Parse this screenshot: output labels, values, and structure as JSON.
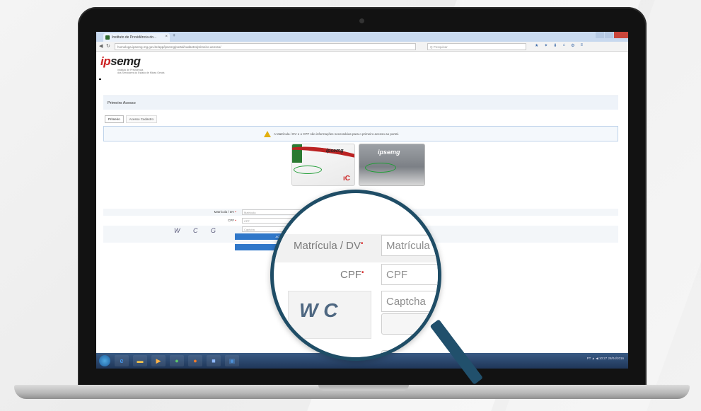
{
  "browser": {
    "tab_title": "Instituto de Previdência do...",
    "tab_close": "×",
    "new_tab": "+",
    "url": "homologa.ipsemg.mg.gov.br/app/ipsemg/portal/cadastro/primeiro-acesso/",
    "search_placeholder": "Q Pesquisar",
    "nav_back": "◀",
    "nav_refresh": "↻"
  },
  "site": {
    "logo_prefix": "ip",
    "logo_main": "semg",
    "logo_subtitle_1": "Instituto de Previdência",
    "logo_subtitle_2": "dos Servidores do Estado de Minas Gerais",
    "section_title": "Primeiro Acesso",
    "tabs": [
      {
        "label": "Primeiro"
      },
      {
        "label": "Acesso Cadastro"
      }
    ],
    "alert_text": "A Matrícula / DV e o CPF são informações necessárias para o primeiro acesso ao portal."
  },
  "cards": {
    "card1_brand": "ipsemg",
    "card1_mark": "ıC",
    "card2_brand": "ipsemg"
  },
  "form": {
    "matricula_label": "Matrícula / DV",
    "matricula_placeholder": "Matrícula",
    "cpf_label": "CPF",
    "cpf_placeholder": "CPF",
    "captcha_text": "W C G",
    "captcha_placeholder": "Captcha",
    "required_mark": "•",
    "button_1": "ACESSAR",
    "button_2": "VOLTAR"
  },
  "taskbar": {
    "tray_text": "PT ▲ ◀ 10:27 28/04/2016"
  },
  "magnifier": {
    "matricula_label": "Matrícula / DV",
    "matricula_placeholder": "Matrícula",
    "cpf_label": "CPF",
    "cpf_placeholder": "CPF",
    "captcha_chars": "W  C",
    "captcha_placeholder": "Captcha",
    "required_mark": "•"
  }
}
